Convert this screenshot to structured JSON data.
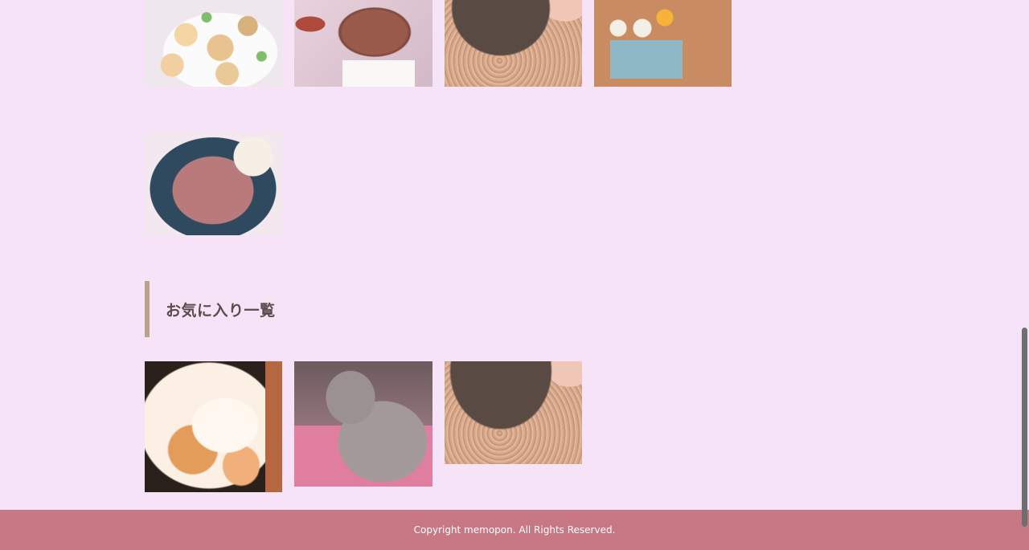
{
  "gallery": {
    "recent_images": [
      {
        "name": "sandwich-platter-photo"
      },
      {
        "name": "bread-loaf-photo"
      },
      {
        "name": "hedgehog-photo"
      },
      {
        "name": "breakfast-tray-photo"
      },
      {
        "name": "roast-beef-photo"
      }
    ]
  },
  "favorites": {
    "heading": "お気に入り一覧",
    "accent_color": "#b7a48e",
    "images": [
      {
        "name": "sleeping-cat-photo"
      },
      {
        "name": "gray-cat-photo"
      },
      {
        "name": "hedgehog-photo"
      }
    ]
  },
  "footer": {
    "copyright": "Copyright memopon. All Rights Reserved.",
    "background_color": "#c87884"
  },
  "colors": {
    "page_background": "#f6e3f7"
  }
}
